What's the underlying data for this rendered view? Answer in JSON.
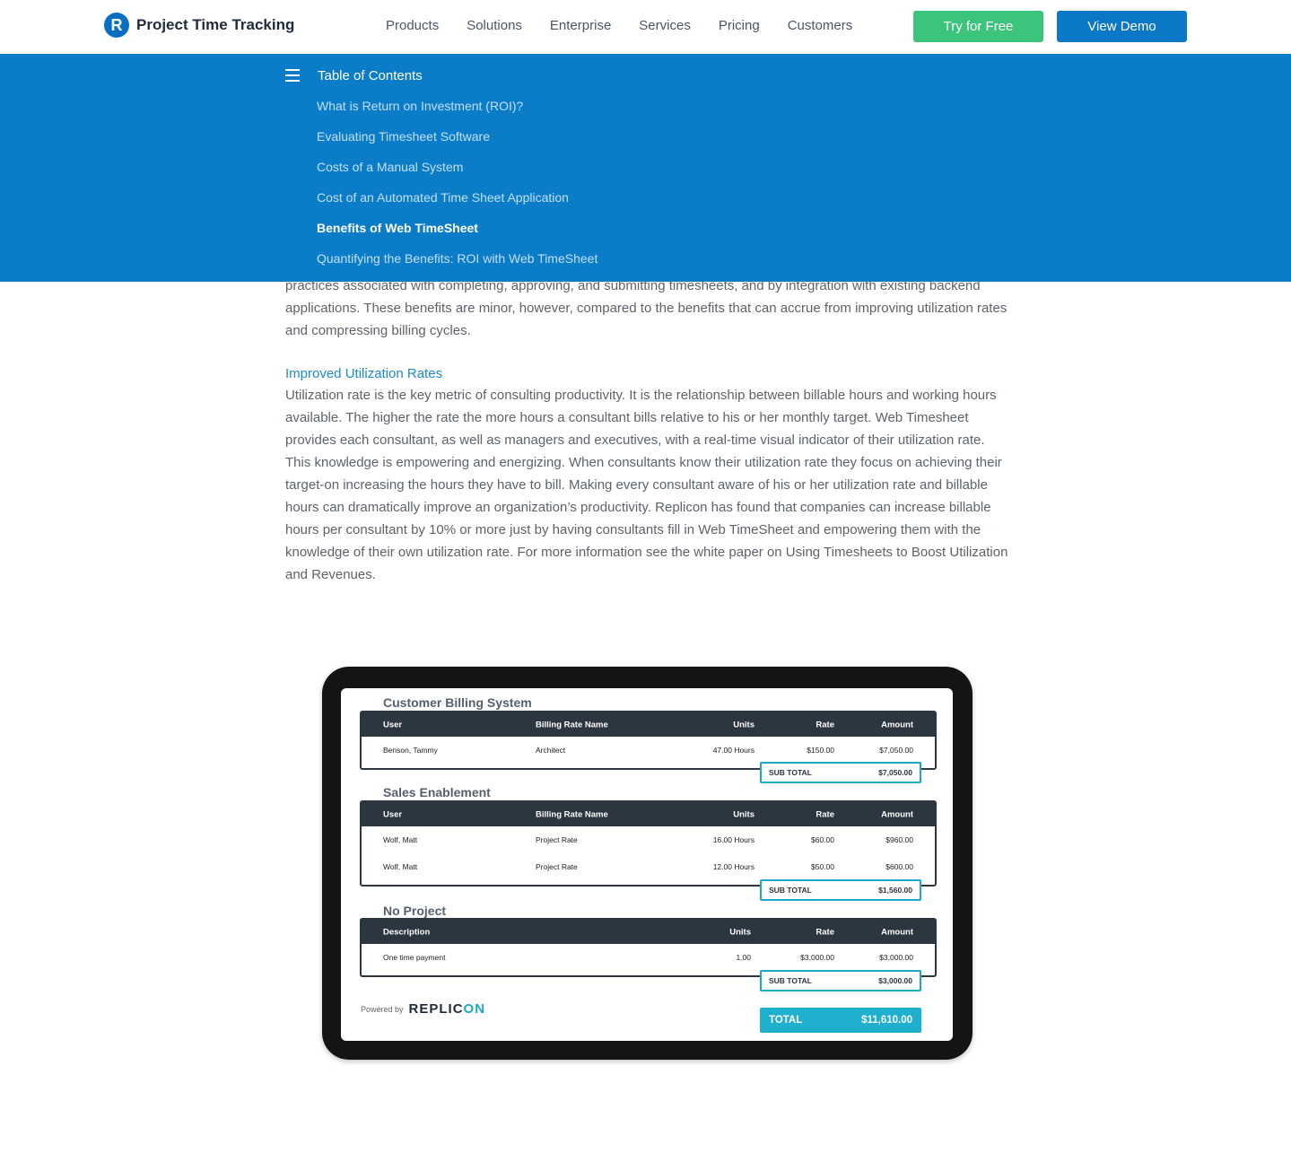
{
  "header": {
    "logo_letter": "R",
    "brand": "Project Time Tracking",
    "nav": [
      "Products",
      "Solutions",
      "Enterprise",
      "Services",
      "Pricing",
      "Customers"
    ],
    "try_button": "Try for Free",
    "demo_button": "View Demo"
  },
  "toc": {
    "title": "Table of Contents",
    "items": [
      "What is Return on Investment (ROI)?",
      "Evaluating Timesheet Software",
      "Costs of a Manual System",
      "Cost of an Automated Time Sheet Application",
      "Benefits of Web TimeSheet",
      "Quantifying the Benefits: ROI with Web TimeSheet"
    ],
    "active": "Benefits of Web TimeSheet"
  },
  "article": {
    "intro": "practices associated with completing, approving, and submitting timesheets, and by integration with existing backend applications. These benefits are minor, however, compared to the benefits that can accrue from improving utilization rates and compressing billing cycles.",
    "subheading": "Improved Utilization Rates",
    "body": "Utilization rate is the key metric of consulting productivity. It is the relationship between billable hours and working hours available. The higher the rate the more hours a consultant bills relative to his or her monthly target. Web Timesheet provides each consultant, as well as managers and executives, with a real-time visual indicator of their utilization rate. This knowledge is empowering and energizing. When consultants know their utilization rate they focus on achieving their target-on increasing the hours they have to bill. Making every consultant aware of his or her utilization rate and billable hours can dramatically improve an organization’s productivity. Replicon has found that companies can increase billable hours per consultant by 10% or more just by having consultants fill in Web TimeSheet and empowering them with the knowledge of their own utilization rate. For more information see the white paper on Using Timesheets to Boost Utilization and Revenues."
  },
  "billing": {
    "sections": [
      {
        "title": "Customer Billing System",
        "headers": [
          "User",
          "Billing Rate Name",
          "Units",
          "Rate",
          "Amount"
        ],
        "rows": [
          [
            "Benson, Tammy",
            "Architect",
            "47.00 Hours",
            "$150.00",
            "$7,050.00"
          ]
        ],
        "subtotal_label": "SUB TOTAL",
        "subtotal": "$7,050.00"
      },
      {
        "title": "Sales Enablement",
        "headers": [
          "User",
          "Billing Rate Name",
          "Units",
          "Rate",
          "Amount"
        ],
        "rows": [
          [
            "Wolf, Matt",
            "Project Rate",
            "16.00 Hours",
            "$60.00",
            "$960.00"
          ],
          [
            "Wolf, Matt",
            "Project Rate",
            "12.00 Hours",
            "$50.00",
            "$600.00"
          ]
        ],
        "subtotal_label": "SUB TOTAL",
        "subtotal": "$1,560.00"
      },
      {
        "title": "No Project",
        "headers": [
          "Description",
          "",
          "Units",
          "Rate",
          "Amount"
        ],
        "rows": [
          [
            "One time payment",
            "",
            "1.00",
            "$3,000.00",
            "$3,000.00"
          ]
        ],
        "subtotal_label": "SUB TOTAL",
        "subtotal": "$3,000.00"
      }
    ],
    "powered_by": "Powered by",
    "brand_main": "REPLIC",
    "brand_accent": "ON",
    "total_label": "TOTAL",
    "total": "$11,610.00"
  }
}
